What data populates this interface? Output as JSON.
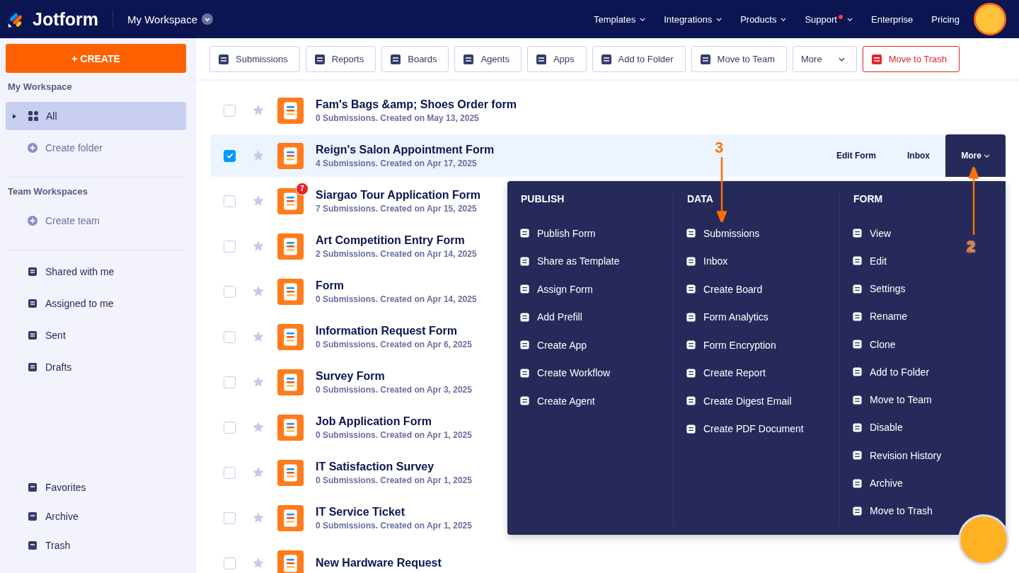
{
  "header": {
    "logo": "Jotform",
    "workspace": "My Workspace",
    "nav": [
      {
        "label": "Templates",
        "dropdown": true,
        "notification": false
      },
      {
        "label": "Integrations",
        "dropdown": true,
        "notification": false
      },
      {
        "label": "Products",
        "dropdown": true,
        "notification": false
      },
      {
        "label": "Support",
        "dropdown": true,
        "notification": true
      },
      {
        "label": "Enterprise",
        "dropdown": false,
        "notification": false
      },
      {
        "label": "Pricing",
        "dropdown": false,
        "notification": false
      }
    ]
  },
  "sidebar": {
    "create_button": "+ CREATE",
    "sections": [
      {
        "heading": "My Workspace",
        "items": [
          {
            "label": "All",
            "kind": "folder",
            "selected": true
          },
          {
            "label": "Create folder",
            "kind": "create",
            "selected": false
          }
        ]
      },
      {
        "heading": "Team Workspaces",
        "items": [
          {
            "label": "Create team",
            "kind": "create",
            "selected": false
          }
        ]
      },
      {
        "items": [
          {
            "label": "Shared with me",
            "kind": "item",
            "selected": false
          },
          {
            "label": "Assigned to me",
            "kind": "item",
            "selected": false
          },
          {
            "label": "Sent",
            "kind": "item",
            "selected": false
          },
          {
            "label": "Drafts",
            "kind": "item",
            "selected": false
          }
        ]
      }
    ],
    "bottom_items": [
      {
        "label": "Favorites",
        "selected": false
      },
      {
        "label": "Archive",
        "selected": false
      },
      {
        "label": "Trash",
        "selected": false
      }
    ]
  },
  "toolbar": [
    {
      "label": "Submissions",
      "kind": "normal",
      "dropdown": false
    },
    {
      "label": "Reports",
      "kind": "normal",
      "dropdown": false
    },
    {
      "label": "Boards",
      "kind": "normal",
      "dropdown": false
    },
    {
      "label": "Agents",
      "kind": "normal",
      "dropdown": false
    },
    {
      "label": "Apps",
      "kind": "normal",
      "dropdown": false
    },
    {
      "label": "Add to Folder",
      "kind": "normal",
      "dropdown": false
    },
    {
      "label": "Move to Team",
      "kind": "normal",
      "dropdown": false
    },
    {
      "label": "More",
      "kind": "normal",
      "dropdown": true
    },
    {
      "label": "Move to Trash",
      "kind": "danger",
      "dropdown": false
    }
  ],
  "forms": [
    {
      "title": "Fam's Bags &amp; Shoes Order form",
      "subtitle": "0 Submissions. Created on May 13, 2025",
      "checked": false
    },
    {
      "title": "Reign's Salon Appointment Form",
      "subtitle": "4 Submissions. Created on Apr 17, 2025",
      "checked": true,
      "actions": [
        "Edit Form",
        "Inbox",
        "More"
      ]
    },
    {
      "title": "Siargao Tour Application Form",
      "subtitle": "7 Submissions. Created on Apr 15, 2025",
      "checked": false,
      "badge": "7"
    },
    {
      "title": "Art Competition Entry Form",
      "subtitle": "2 Submissions. Created on Apr 14, 2025",
      "checked": false
    },
    {
      "title": "Form",
      "subtitle": "0 Submissions. Created on Apr 14, 2025",
      "checked": false
    },
    {
      "title": "Information Request Form",
      "subtitle": "0 Submissions. Created on Apr 6, 2025",
      "checked": false
    },
    {
      "title": "Survey Form",
      "subtitle": "0 Submissions. Created on Apr 3, 2025",
      "checked": false
    },
    {
      "title": "Job Application Form",
      "subtitle": "0 Submissions. Created on Apr 1, 2025",
      "checked": false
    },
    {
      "title": "IT Satisfaction Survey",
      "subtitle": "0 Submissions. Created on Apr 1, 2025",
      "checked": false
    },
    {
      "title": "IT Service Ticket",
      "subtitle": "0 Submissions. Created on Apr 1, 2025",
      "checked": false
    },
    {
      "title": "New Hardware Request",
      "checked": false
    }
  ],
  "more_menu": {
    "columns": [
      {
        "heading": "PUBLISH",
        "items": [
          "Publish Form",
          "Share as Template",
          "Assign Form",
          "Add Prefill",
          "Create App",
          "Create Workflow",
          "Create Agent"
        ]
      },
      {
        "heading": "DATA",
        "items": [
          "Submissions",
          "Inbox",
          "Create Board",
          "Form Analytics",
          "Form Encryption",
          "Create Report",
          "Create Digest Email",
          "Create PDF Document"
        ]
      },
      {
        "heading": "FORM",
        "items": [
          "View",
          "Edit",
          "Settings",
          "Rename",
          "Clone",
          "Add to Folder",
          "Move to Team",
          "Disable",
          "Revision History",
          "Archive",
          "Move to Trash"
        ]
      }
    ]
  },
  "annotations": [
    {
      "label": "3"
    },
    {
      "label": "2"
    }
  ]
}
